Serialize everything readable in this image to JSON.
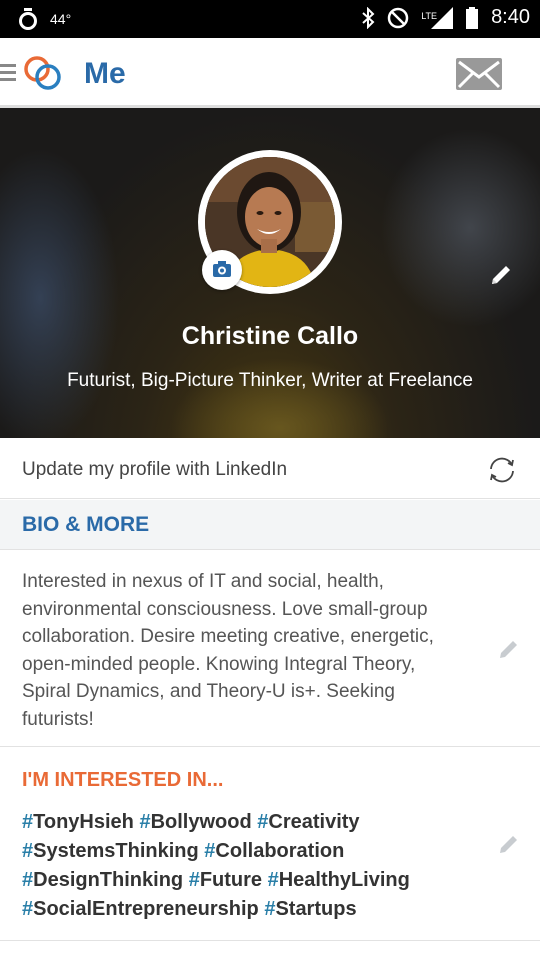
{
  "status_bar": {
    "temperature": "44°",
    "network": "LTE",
    "time": "8:40"
  },
  "app_bar": {
    "title": "Me"
  },
  "profile": {
    "name": "Christine Callo",
    "headline": "Futurist, Big-Picture Thinker, Writer at Freelance"
  },
  "linkedin": {
    "label": "Update my profile with LinkedIn"
  },
  "bio": {
    "header": "BIO & MORE",
    "text": "Interested in nexus of IT and social, health,\nenvironmental consciousness. Love small-group\ncollaboration. Desire meeting creative, energetic,\nopen-minded people. Knowing Integral Theory,\nSpiral Dynamics, and Theory-U is+.  Seeking\nfuturists!"
  },
  "interests": {
    "header": "I'M INTERESTED IN...",
    "lines": [
      [
        "TonyHsieh",
        "Bollywood",
        "Creativity"
      ],
      [
        "SystemsThinking",
        "Collaboration"
      ],
      [
        "DesignThinking",
        "Future",
        "HealthyLiving"
      ],
      [
        "SocialEntrepreneurship",
        "Startups"
      ]
    ]
  },
  "colors": {
    "accent_blue": "#2a6aa8",
    "accent_orange": "#e96a36",
    "hash_blue": "#2a7fa8"
  },
  "icons": [
    "timer-icon",
    "bluetooth-icon",
    "do-not-disturb-icon",
    "signal-icon",
    "hamburger-icon",
    "app-logo-icon",
    "mail-icon",
    "camera-icon",
    "edit-icon",
    "sync-icon"
  ]
}
